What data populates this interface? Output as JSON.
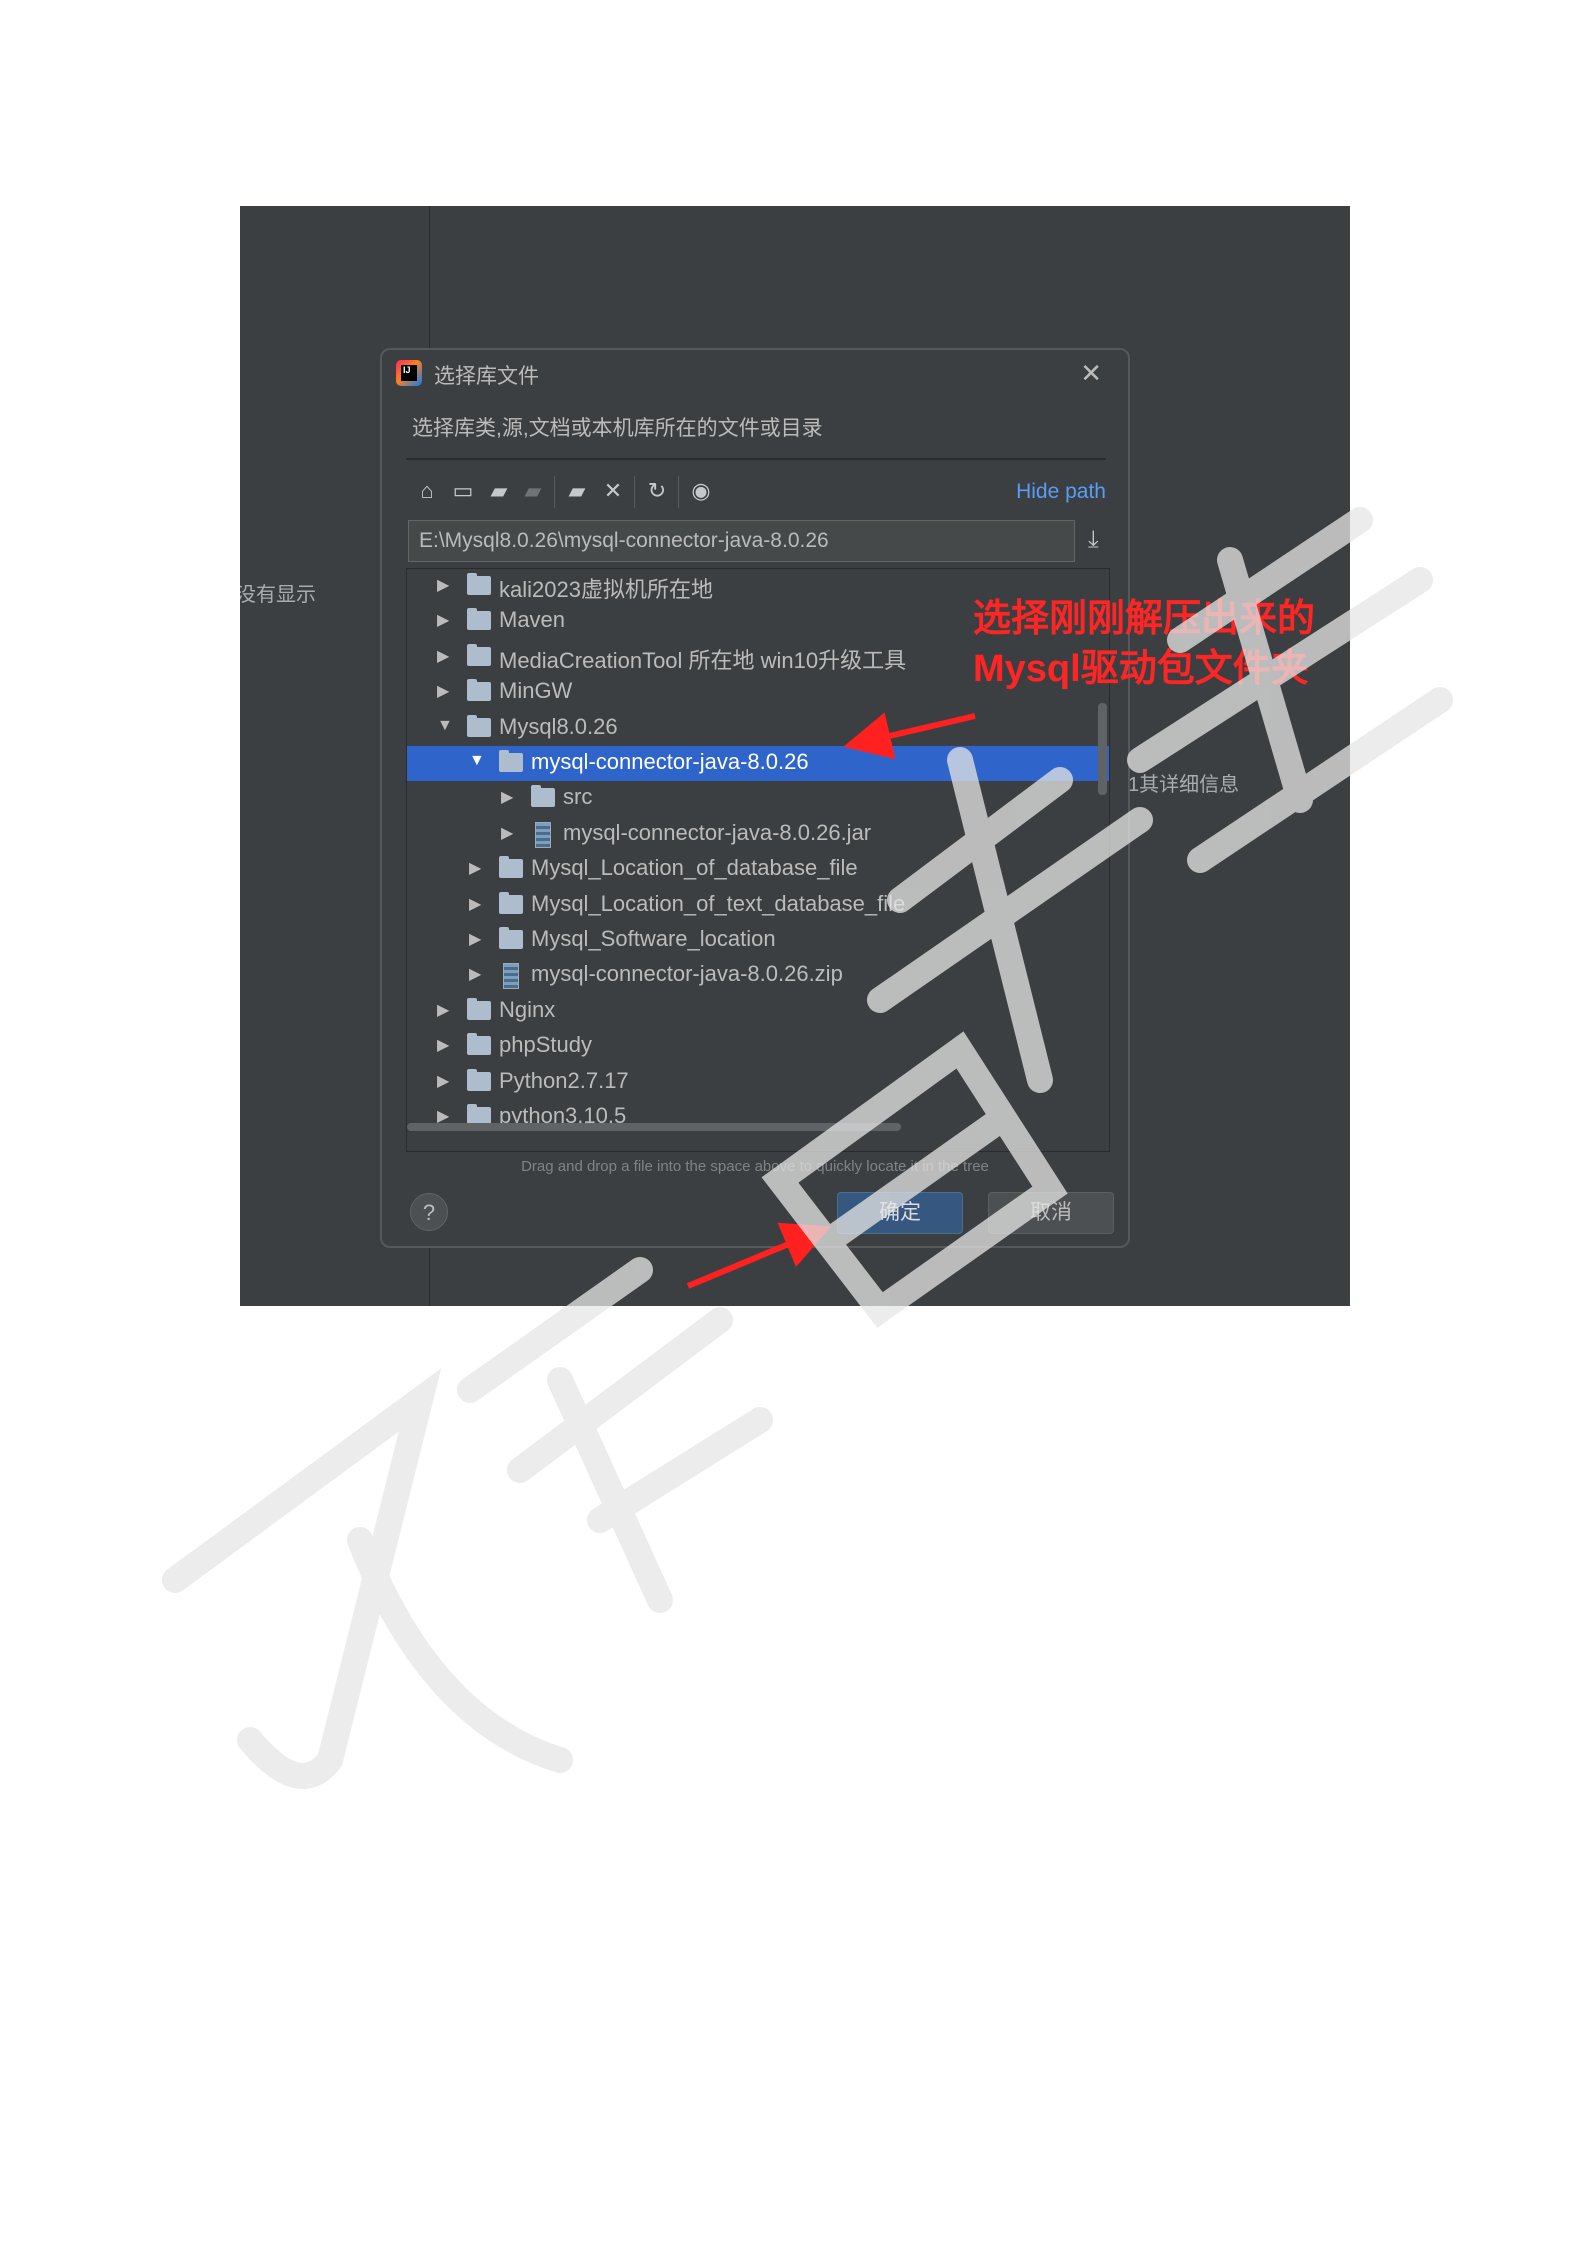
{
  "background": {
    "left_text": "没有显示",
    "right_text": "1其详细信息"
  },
  "dialog": {
    "title": "选择库文件",
    "subtitle": "选择库类,源,文档或本机库所在的文件或目录",
    "hide_path": "Hide path",
    "path_value": "E:\\Mysql8.0.26\\mysql-connector-java-8.0.26",
    "hint": "Drag and drop a file into the space above to quickly locate it in the tree",
    "ok_label": "确定",
    "cancel_label": "取消",
    "help_label": "?"
  },
  "tree": [
    {
      "label": "kali2023虚拟机所在地",
      "icon": "folder",
      "level": 0,
      "expanded": false,
      "selected": false
    },
    {
      "label": "Maven",
      "icon": "folder",
      "level": 0,
      "expanded": false,
      "selected": false
    },
    {
      "label": "MediaCreationTool 所在地 win10升级工具",
      "icon": "folder",
      "level": 0,
      "expanded": false,
      "selected": false
    },
    {
      "label": "MinGW",
      "icon": "folder",
      "level": 0,
      "expanded": false,
      "selected": false
    },
    {
      "label": "Mysql8.0.26",
      "icon": "folder",
      "level": 0,
      "expanded": true,
      "selected": false
    },
    {
      "label": "mysql-connector-java-8.0.26",
      "icon": "folder",
      "level": 1,
      "expanded": true,
      "selected": true
    },
    {
      "label": "src",
      "icon": "folder",
      "level": 2,
      "expanded": false,
      "selected": false
    },
    {
      "label": "mysql-connector-java-8.0.26.jar",
      "icon": "archive",
      "level": 2,
      "expanded": false,
      "selected": false
    },
    {
      "label": "Mysql_Location_of_database_file",
      "icon": "folder",
      "level": 1,
      "expanded": false,
      "selected": false
    },
    {
      "label": "Mysql_Location_of_text_database_file",
      "icon": "folder",
      "level": 1,
      "expanded": false,
      "selected": false
    },
    {
      "label": "Mysql_Software_location",
      "icon": "folder",
      "level": 1,
      "expanded": false,
      "selected": false
    },
    {
      "label": "mysql-connector-java-8.0.26.zip",
      "icon": "archive",
      "level": 1,
      "expanded": false,
      "selected": false
    },
    {
      "label": "Nginx",
      "icon": "folder",
      "level": 0,
      "expanded": false,
      "selected": false
    },
    {
      "label": "phpStudy",
      "icon": "folder",
      "level": 0,
      "expanded": false,
      "selected": false
    },
    {
      "label": "Python2.7.17",
      "icon": "folder",
      "level": 0,
      "expanded": false,
      "selected": false
    },
    {
      "label": "python3.10.5",
      "icon": "folder",
      "level": 0,
      "expanded": false,
      "selected": false
    }
  ],
  "annotation": {
    "line1": "选择刚刚解压出来的",
    "line2": "Mysql驱动包文件夹",
    "color": "#ff2525"
  },
  "toolbar_icons": [
    "home-icon",
    "desktop-icon",
    "project-folder-icon",
    "module-folder-icon",
    "new-folder-icon",
    "delete-icon",
    "refresh-icon",
    "show-hidden-icon"
  ],
  "watermark": {
    "text": "及辞日知醒",
    "color": "#e8e8e8"
  }
}
